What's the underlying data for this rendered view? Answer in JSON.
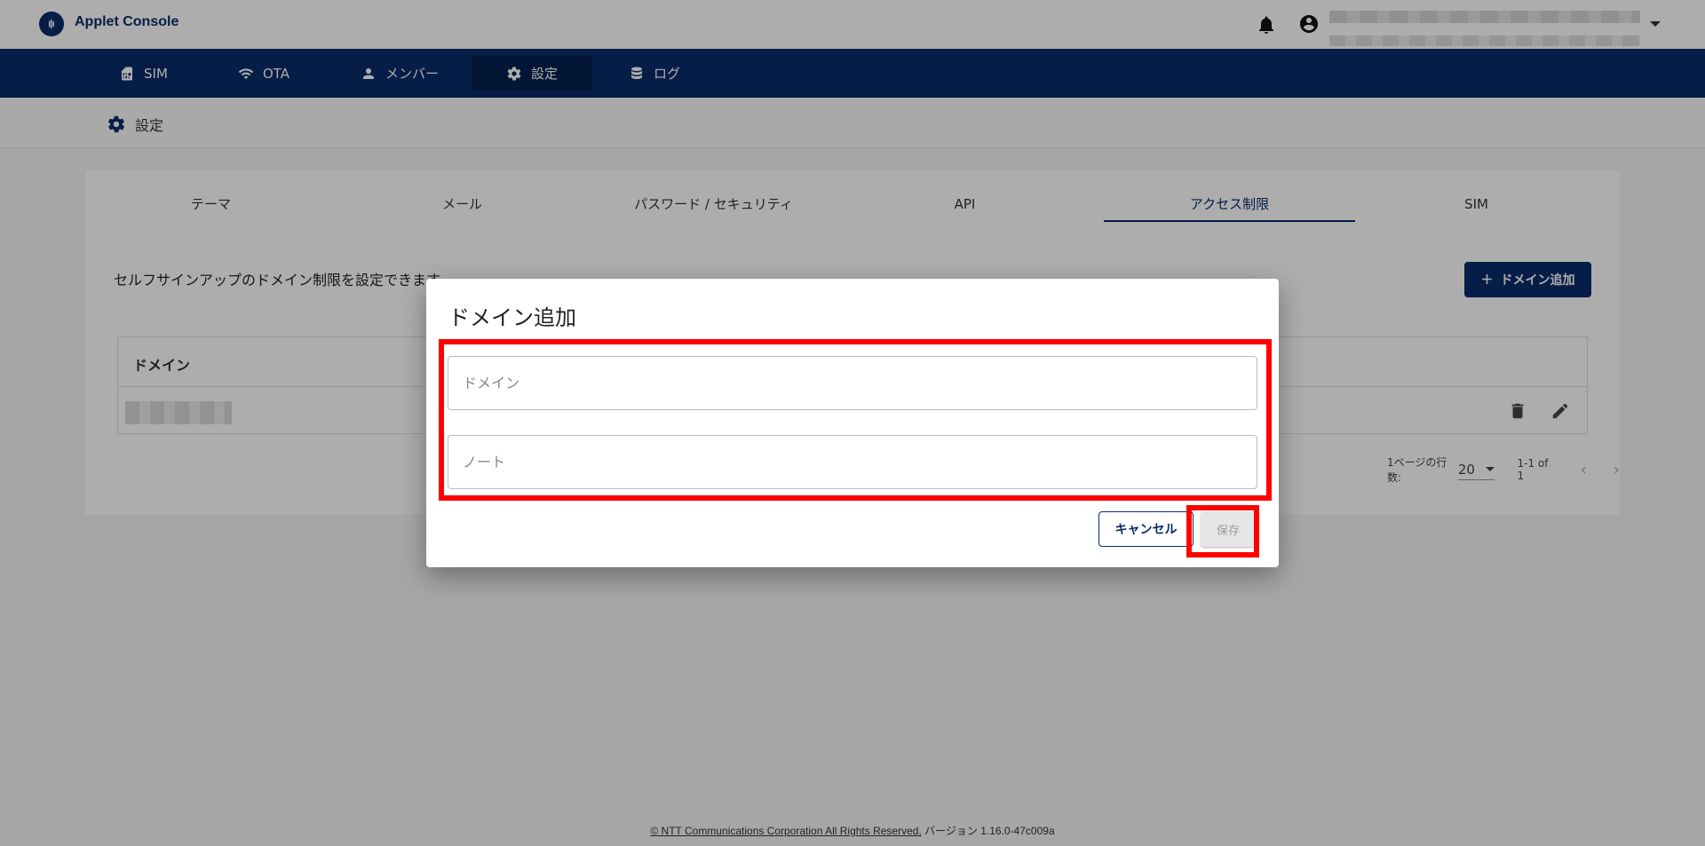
{
  "header": {
    "app_title": "Applet Console",
    "icons": [
      "bell-icon",
      "account-circle-icon",
      "chevron-down-icon"
    ]
  },
  "nav": {
    "items": [
      {
        "label": "SIM",
        "icon": "sim-card-icon"
      },
      {
        "label": "OTA",
        "icon": "wifi-icon"
      },
      {
        "label": "メンバー",
        "icon": "person-icon"
      },
      {
        "label": "設定",
        "icon": "gear-icon",
        "active": true
      },
      {
        "label": "ログ",
        "icon": "database-icon"
      }
    ]
  },
  "breadcrumb": {
    "label": "設定"
  },
  "tabs": [
    {
      "label": "テーマ"
    },
    {
      "label": "メール"
    },
    {
      "label": "パスワード / セキュリティ"
    },
    {
      "label": "API"
    },
    {
      "label": "アクセス制限",
      "active": true
    },
    {
      "label": "SIM"
    }
  ],
  "content": {
    "description": "セルフサインアップのドメイン制限を設定できます。",
    "add_button": "ドメイン追加",
    "table_header": "ドメイン",
    "pager": {
      "rows_per_page_label": "1ページの行数:",
      "rows_per_page": "20",
      "range": "1-1 of 1"
    }
  },
  "dialog": {
    "title": "ドメイン追加",
    "domain_placeholder": "ドメイン",
    "note_placeholder": "ノート",
    "cancel_label": "キャンセル",
    "save_label": "保存"
  },
  "footer": {
    "copyright": "© NTT Communications Corporation All Rights Reserved.",
    "version": "バージョン 1.16.0-47c009a"
  },
  "colors": {
    "primary": "#0a2b6b",
    "highlight": "#ff0000"
  }
}
